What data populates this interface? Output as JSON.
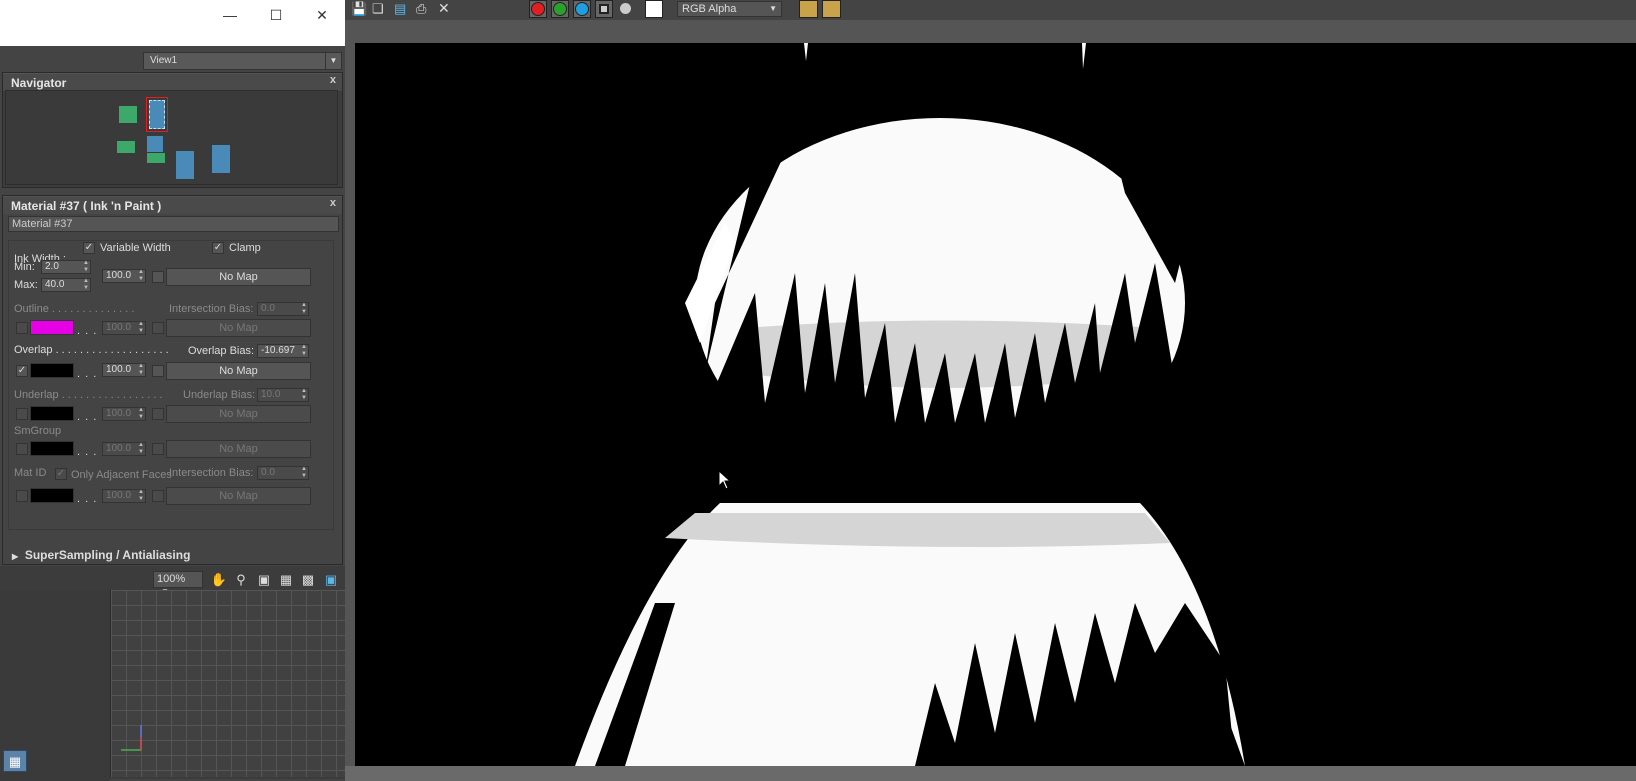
{
  "view_selector": {
    "value": "View1"
  },
  "navigator": {
    "title": "Navigator",
    "close": "x"
  },
  "material": {
    "title": "Material #37  ( Ink 'n Paint )",
    "close": "x",
    "name_field": "Material #37",
    "ink_width": {
      "label": "Ink Width :",
      "variable_width_label": "Variable Width",
      "clamp_label": "Clamp",
      "min_label": "Min:",
      "min_value": "2.0",
      "max_label": "Max:",
      "max_value": "40.0",
      "amount": "100.0",
      "map": "No Map"
    },
    "outline": {
      "label": "Outline . . . . . . . . . . . . . .",
      "bias_label": "Intersection Bias:",
      "bias_value": "0.0",
      "amount": "100.0",
      "map": "No Map",
      "color": "#e600e6"
    },
    "overlap": {
      "label": "Overlap . . . . . . . . . . . . . . . . . . .",
      "bias_label": "Overlap Bias:",
      "bias_value": "-10.697",
      "amount": "100.0",
      "map": "No Map",
      "color": "#000000"
    },
    "underlap": {
      "label": "Underlap . . . . . . . . . . . . . . . . .",
      "bias_label": "Underlap Bias:",
      "bias_value": "10.0",
      "amount": "100.0",
      "map": "No Map"
    },
    "smgroup": {
      "label": "SmGroup",
      "amount": "100.0",
      "map": "No Map"
    },
    "matid": {
      "label": "Mat ID",
      "adjacent_label": "Only Adjacent Faces",
      "bias_label": "Intersection Bias:",
      "bias_value": "0.0",
      "amount": "100.0",
      "map": "No Map"
    },
    "dots": ". . . ."
  },
  "supersampling": {
    "label": "SuperSampling / Antialiasing"
  },
  "zoom": {
    "value": "100%"
  },
  "channel_selector": {
    "value": "RGB Alpha"
  },
  "colors": {
    "red": "#e02020",
    "green": "#2ca02c",
    "blue": "#1f9fdf"
  }
}
